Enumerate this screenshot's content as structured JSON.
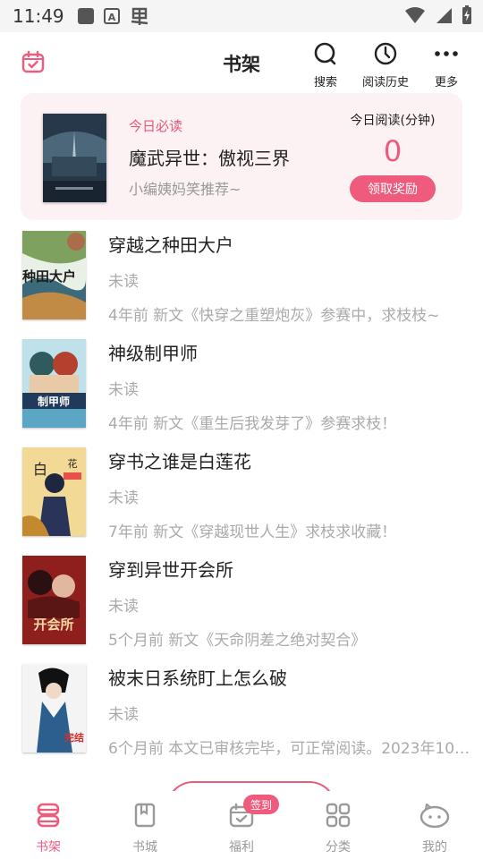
{
  "status_bar": {
    "time": "11:49",
    "icons_left": [
      "square-app-icon",
      "font-a-icon",
      "dou-app-icon"
    ],
    "icons_right": [
      "wifi-icon",
      "signal-icon",
      "battery-charging-icon"
    ]
  },
  "header": {
    "title": "书架",
    "left_icon": "calendar-check-icon",
    "actions": [
      {
        "label": "搜索",
        "icon": "search-icon"
      },
      {
        "label": "阅读历史",
        "icon": "clock-icon"
      },
      {
        "label": "更多",
        "icon": "more-dots-icon"
      }
    ]
  },
  "banner": {
    "tag": "今日必读",
    "book_title": "魔武异世：傲视三界",
    "subtitle": "小编姨妈笑推荐~",
    "reading_label": "今日阅读(分钟)",
    "minutes": "0",
    "reward_button": "领取奖励"
  },
  "books": [
    {
      "title": "穿越之种田大户",
      "status": "未读",
      "update": "4年前 新文《快穿之重塑炮灰》参赛中，求枝枝~"
    },
    {
      "title": "神级制甲师",
      "status": "未读",
      "update": "4年前 新文《重生后我发芽了》参赛求枝！"
    },
    {
      "title": "穿书之谁是白莲花",
      "status": "未读",
      "update": "7年前 新文《穿越现世人生》求枝求收藏！"
    },
    {
      "title": "穿到异世开会所",
      "status": "未读",
      "update": "5个月前 新文《天命阴差之绝对契合》"
    },
    {
      "title": "被末日系统盯上怎么破",
      "status": "未读",
      "update": "6个月前 本文已审核完毕，可正常阅读。2023年10…"
    }
  ],
  "bottom_nav": {
    "items": [
      {
        "label": "书架",
        "icon": "bookshelf-icon",
        "active": true
      },
      {
        "label": "书城",
        "icon": "book-icon",
        "active": false
      },
      {
        "label": "福利",
        "icon": "calendar-check-icon",
        "active": false
      },
      {
        "label": "分类",
        "icon": "grid-icon",
        "active": false
      },
      {
        "label": "我的",
        "icon": "face-icon",
        "active": false
      }
    ],
    "badge": "签到"
  },
  "colors": {
    "accent": "#ef5b7d",
    "banner_bg": "#fcf1f3",
    "muted_text": "#aaaaaa"
  }
}
